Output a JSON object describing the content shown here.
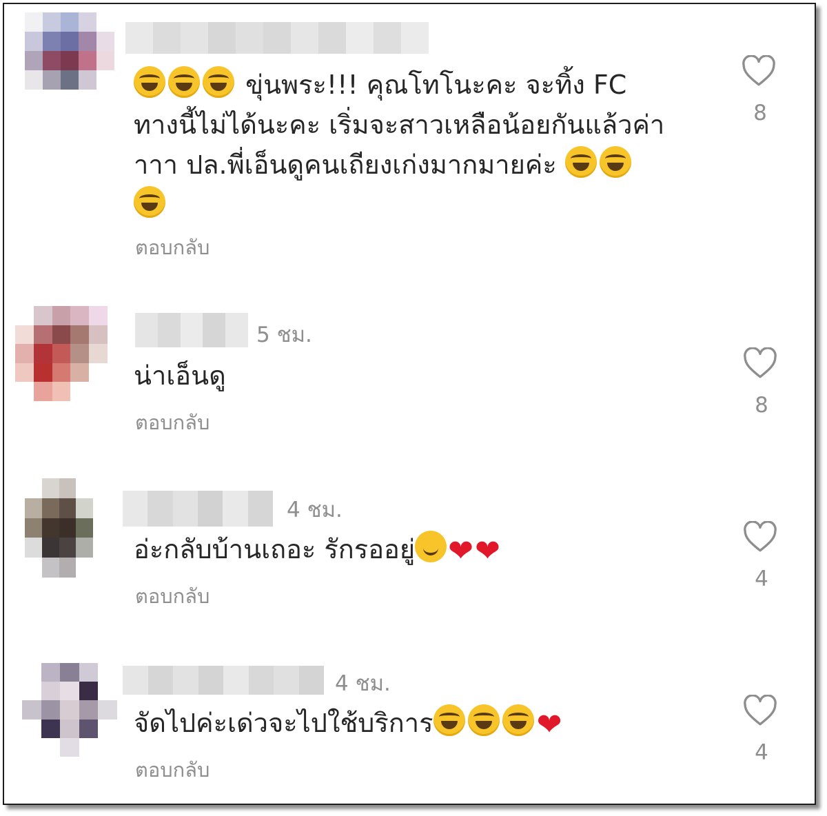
{
  "comments": [
    {
      "time": "",
      "lines": [
        "ขุ่นพระ!!! คุณโทโนะคะ จะทิ้ง FC",
        "ทางนี้ไม่ได้นะคะ เริ่มจะสาวเหลือน้อยกันแล้วค่า",
        "าาา ปล.พี่เอ็นดูคนเถียงเก่งมากมายค่ะ"
      ],
      "reply": "ตอบกลับ",
      "likes": "8"
    },
    {
      "time": "5 ชม.",
      "text": "น่าเอ็นดู",
      "reply": "ตอบกลับ",
      "likes": "8"
    },
    {
      "time": "4 ชม.",
      "text": "อ่ะกลับบ้านเถอะ รักรออยู่",
      "reply": "ตอบกลับ",
      "likes": "4"
    },
    {
      "time": "4 ชม.",
      "text": "จัดไปค่ะเด่วจะไปใช้บริการ",
      "reply": "ตอบกลับ",
      "likes": "4"
    }
  ],
  "icons": {
    "like": "heart-outline-icon",
    "emoji_laugh": "face-with-tears-of-joy",
    "emoji_smile": "smiling-face",
    "emoji_heart": "red-heart"
  },
  "colors": {
    "text": "#262626",
    "muted": "#8e8e8e",
    "heart_red": "#e0182a"
  }
}
